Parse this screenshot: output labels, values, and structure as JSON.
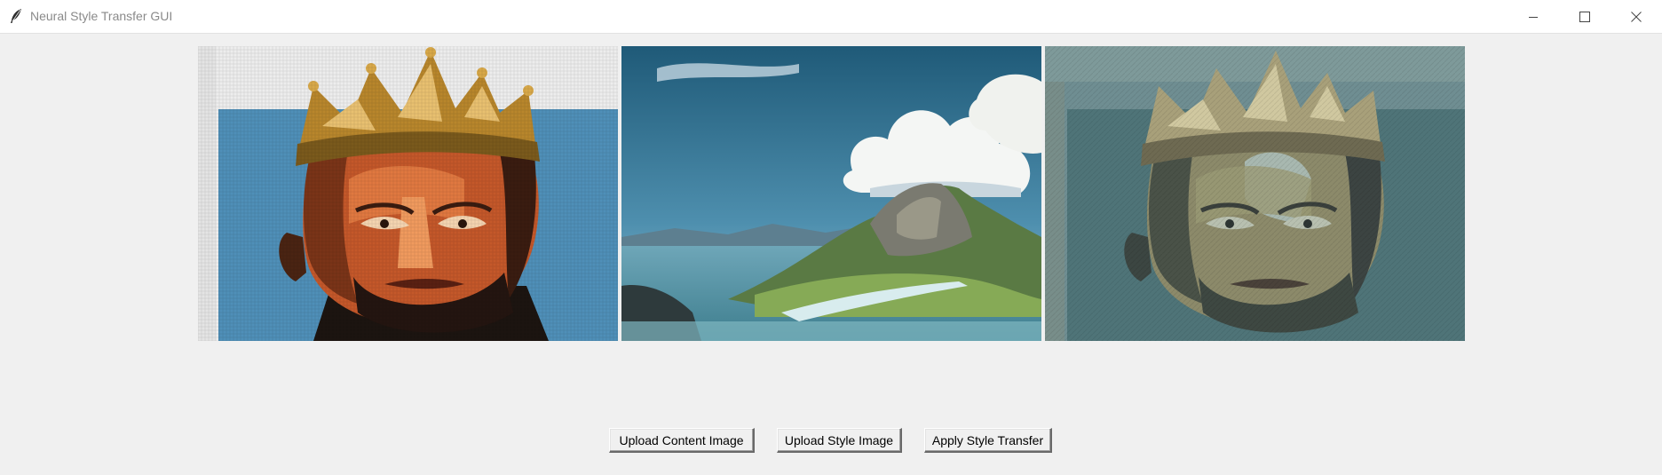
{
  "window": {
    "title": "Neural Style Transfer GUI",
    "controls": {
      "minimize_icon": "minimize-icon",
      "maximize_icon": "maximize-icon",
      "close_icon": "close-icon"
    }
  },
  "images": {
    "content": {
      "kind": "content-image"
    },
    "style": {
      "kind": "style-image"
    },
    "result": {
      "kind": "stylized-result-image"
    }
  },
  "buttons": {
    "upload_content": "Upload Content Image",
    "upload_style": "Upload Style Image",
    "apply_transfer": "Apply Style Transfer"
  },
  "colors": {
    "window_bg": "#f0f0f0",
    "titlebar_bg": "#ffffff",
    "title_text": "#8a8a8a"
  }
}
